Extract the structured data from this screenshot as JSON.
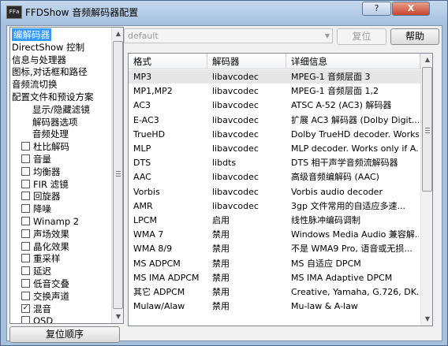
{
  "window": {
    "title": "FFDShow 音频解码器配置",
    "app_icon": "ffa-icon",
    "controls": {
      "help": "?",
      "close": "X"
    }
  },
  "tree": {
    "items": [
      {
        "label": "编解码器",
        "indent": 0,
        "selected": true
      },
      {
        "label": "DirectShow 控制",
        "indent": 0
      },
      {
        "label": "信息与处理器",
        "indent": 0
      },
      {
        "label": "图标,对话框和路径",
        "indent": 0
      },
      {
        "label": "音频流切换",
        "indent": 0
      },
      {
        "label": "配置文件和预设方案",
        "indent": 0
      },
      {
        "label": "显示/隐藏滤镜",
        "indent": 2
      },
      {
        "label": "解码器选项",
        "indent": 2
      },
      {
        "label": "音频处理",
        "indent": 2
      },
      {
        "label": "杜比解码",
        "checkbox": true,
        "checked": false
      },
      {
        "label": "音量",
        "checkbox": true,
        "checked": false
      },
      {
        "label": "均衡器",
        "checkbox": true,
        "checked": false
      },
      {
        "label": "FIR 滤镜",
        "checkbox": true,
        "checked": false
      },
      {
        "label": "回旋器",
        "checkbox": true,
        "checked": false
      },
      {
        "label": "降噪",
        "checkbox": true,
        "checked": false
      },
      {
        "label": "Winamp 2",
        "checkbox": true,
        "checked": false
      },
      {
        "label": "声场效果",
        "checkbox": true,
        "checked": false
      },
      {
        "label": "晶化效果",
        "checkbox": true,
        "checked": false
      },
      {
        "label": "重采样",
        "checkbox": true,
        "checked": false
      },
      {
        "label": "延迟",
        "checkbox": true,
        "checked": false
      },
      {
        "label": "低音交叠",
        "checkbox": true,
        "checked": false
      },
      {
        "label": "交换声道",
        "checkbox": true,
        "checked": false
      },
      {
        "label": "混音",
        "checkbox": true,
        "checked": true
      },
      {
        "label": "OSD",
        "checkbox": true,
        "checked": false
      }
    ]
  },
  "buttons": {
    "reset_order": "复位顺序",
    "reset": "复位",
    "help": "帮助"
  },
  "preset": {
    "value": "default"
  },
  "table": {
    "columns": [
      "格式",
      "解码器",
      "详细信息"
    ],
    "rows": [
      {
        "format": "MP3",
        "decoder": "libavcodec",
        "details": "MPEG-1 音频层面 3",
        "selected": true
      },
      {
        "format": "MP1,MP2",
        "decoder": "libavcodec",
        "details": "MPEG-1 音频层面 1,2"
      },
      {
        "format": "AC3",
        "decoder": "libavcodec",
        "details": "ATSC A-52 (AC3) 解码器"
      },
      {
        "format": "E-AC3",
        "decoder": "libavcodec",
        "details": "扩展 AC3 解码器 (Dolby Digit..."
      },
      {
        "format": "TrueHD",
        "decoder": "libavcodec",
        "details": "Dolby TrueHD decoder. Works..."
      },
      {
        "format": "MLP",
        "decoder": "libavcodec",
        "details": "MLP decoder. Works only if A..."
      },
      {
        "format": "DTS",
        "decoder": "libdts",
        "details": "DTS 相干声学音频流解码器"
      },
      {
        "format": "AAC",
        "decoder": "libavcodec",
        "details": "高级音频编解码 (AAC)"
      },
      {
        "format": "Vorbis",
        "decoder": "libavcodec",
        "details": "Vorbis audio decoder"
      },
      {
        "format": "AMR",
        "decoder": "libavcodec",
        "details": "3gp 文件常用的自适应多速..."
      },
      {
        "format": "LPCM",
        "decoder": "启用",
        "details": "线性脉冲编码调制"
      },
      {
        "format": "WMA 7",
        "decoder": "禁用",
        "details": "Windows Media Audio 兼容解..."
      },
      {
        "format": "WMA 8/9",
        "decoder": "禁用",
        "details": "不是 WMA9 Pro, 语音或无损..."
      },
      {
        "format": "MS ADPCM",
        "decoder": "禁用",
        "details": "MS 自适应 DPCM"
      },
      {
        "format": "MS IMA ADPCM",
        "decoder": "禁用",
        "details": "MS IMA Adaptive DPCM"
      },
      {
        "format": "其它 ADPCM",
        "decoder": "禁用",
        "details": "Creative, Yamaha, G.726, DK..."
      },
      {
        "format": "Mulaw/Alaw",
        "decoder": "禁用",
        "details": "Mu-law & A-law"
      }
    ]
  }
}
